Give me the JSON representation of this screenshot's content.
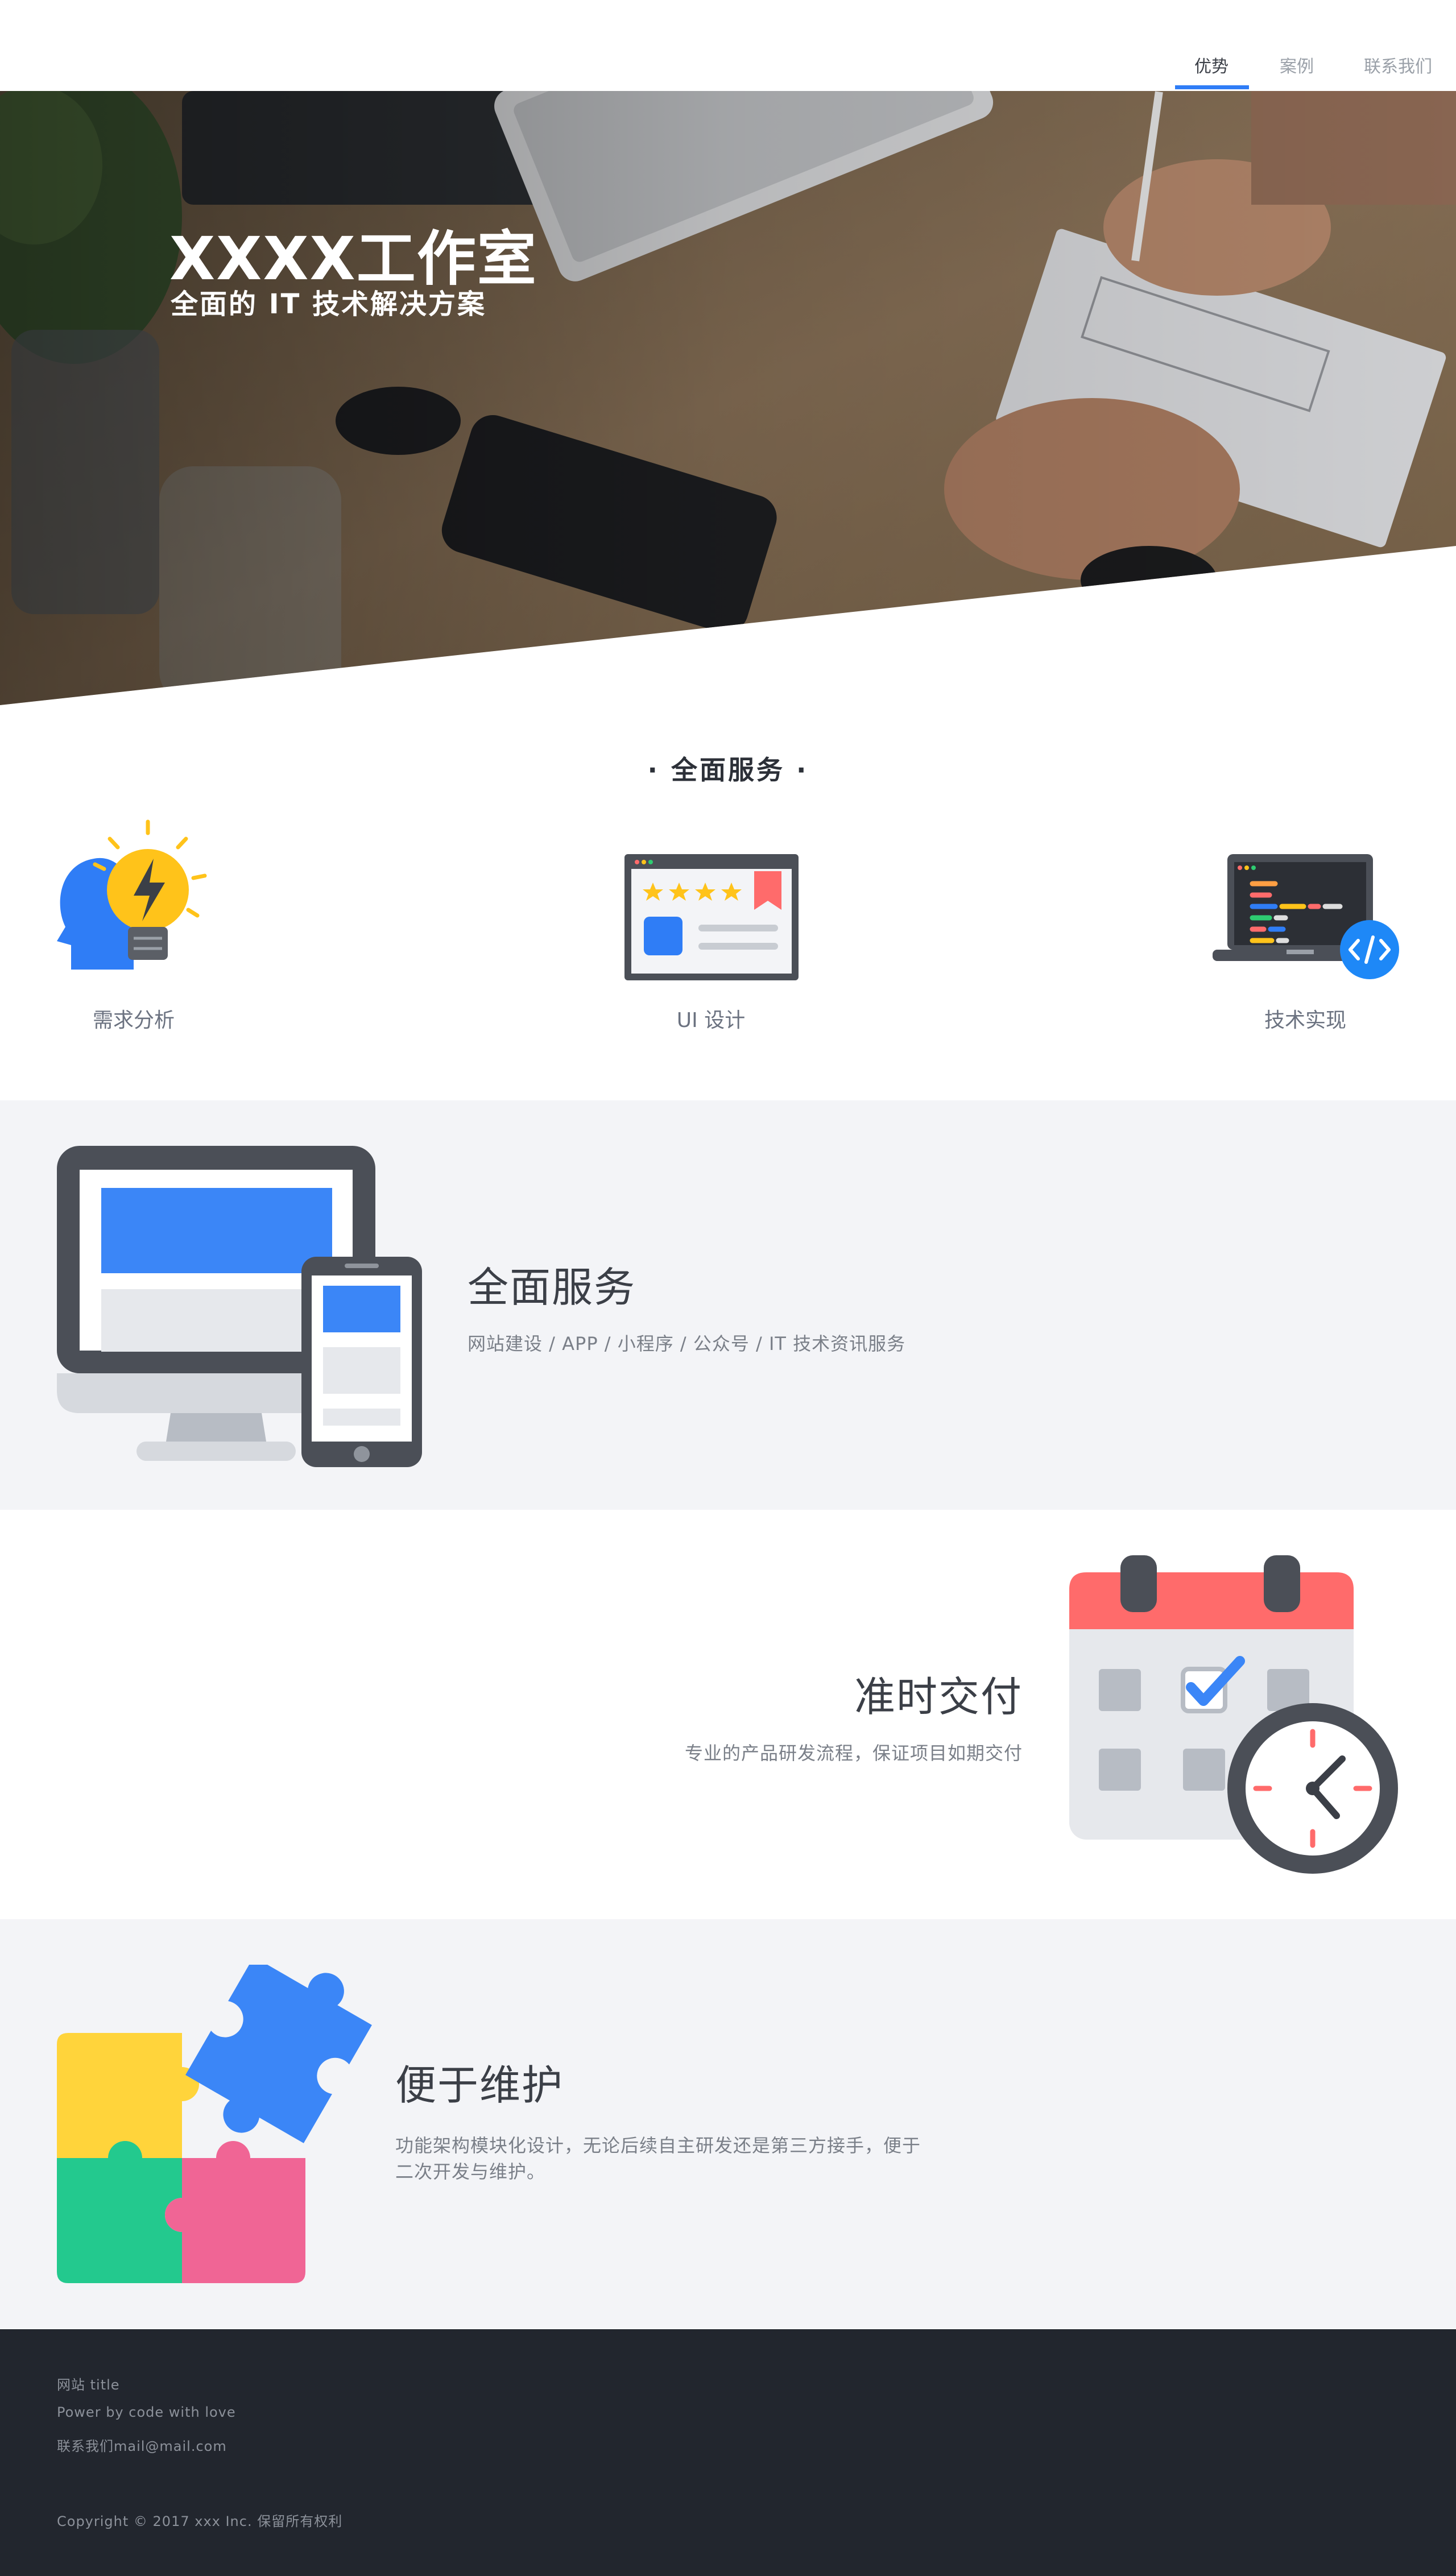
{
  "nav": {
    "items": [
      {
        "label": "优势",
        "active": true
      },
      {
        "label": "案例",
        "active": false
      },
      {
        "label": "联系我们",
        "active": false
      }
    ],
    "accent": "#2f7df6"
  },
  "hero": {
    "title": "XXXX工作室",
    "subtitle": "全面的 IT 技术解决方案"
  },
  "features": {
    "title": "· 全面服务 ·",
    "items": [
      {
        "label": "需求分析",
        "icon": "lightbulb-head-icon"
      },
      {
        "label": "UI 设计",
        "icon": "ui-design-window-icon"
      },
      {
        "label": "技术实现",
        "icon": "code-laptop-icon"
      }
    ]
  },
  "bands": [
    {
      "title": "全面服务",
      "desc": "网站建设 / APP / 小程序 / 公众号 / IT 技术资讯服务",
      "icon": "devices-icon"
    },
    {
      "title": "准时交付",
      "desc": "专业的产品研发流程，保证项目如期交付",
      "icon": "calendar-clock-icon"
    },
    {
      "title": "便于维护",
      "desc_lines": [
        "功能架构模块化设计，无论后续自主研发还是第三方接手，便于",
        "二次开发与维护。"
      ],
      "icon": "puzzle-icon"
    }
  ],
  "footer": {
    "site_title": "网站 title",
    "power": "Power by code with love",
    "contact": "联系我们mail@mail.com",
    "copyright": "Copyright © 2017 xxx Inc. 保留所有权利"
  }
}
